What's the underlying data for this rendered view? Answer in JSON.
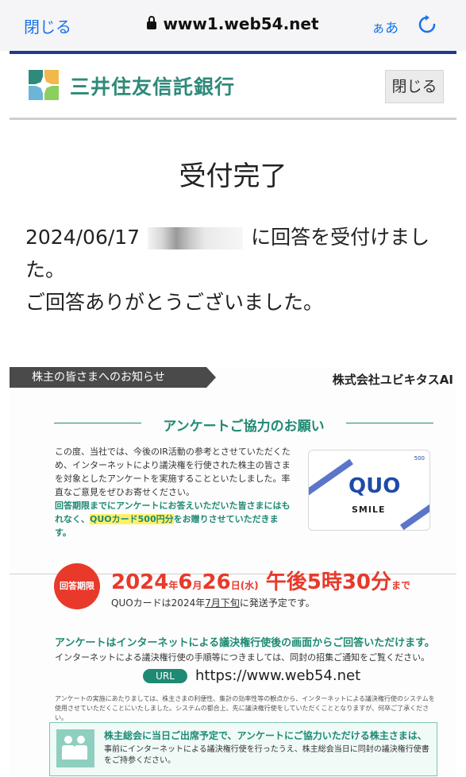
{
  "browser": {
    "close_label": "閉じる",
    "url": "www1.web54.net",
    "aa_label": "ぁあ",
    "reload_icon": "reload-icon"
  },
  "bank_header": {
    "name": "三井住友信託銀行",
    "close_button": "閉じる",
    "accent_color": "#2e8a7a"
  },
  "page": {
    "title": "受付完了",
    "message_date": "2024/06/17",
    "message_part1": "に回答を受付けました。",
    "message_part2": "ご回答ありがとうございました。"
  },
  "notice": {
    "tag": "株主の皆さまへのお知らせ",
    "company": "株式会社ユビキタスAI",
    "heading": "アンケートご協力のお願い",
    "body_plain": "この度、当社では、今後のIR活動の参考とさせていただくため、インターネットにより議決権を行使された株主の皆さまを対象としたアンケートを実施することといたしました。率直なご意見をぜひお寄せください。",
    "body_green1": "回答期限までにアンケートにお答えいただいた皆さまにはもれなく、",
    "body_highlight": "QUOカード500円分",
    "body_green2": "をお贈りさせていただきます。",
    "quo_logo": "QUO",
    "quo_smile": "SMILE",
    "quo_corner": "500",
    "deadline_badge": "回答期限",
    "deadline_date": "2024",
    "deadline_year_suffix": "年",
    "deadline_month": "6",
    "deadline_month_suffix": "月",
    "deadline_day": "26",
    "deadline_day_suffix": "日(水)",
    "deadline_time": "午後5時30分",
    "deadline_until": "まで",
    "ship_text1": "QUOカードは2024年",
    "ship_underline": "7月下旬",
    "ship_text2": "に発送予定です。",
    "internet_title": "アンケートはインターネットによる議決権行使後の画面からご回答いただけます。",
    "internet_sub": "インターネットによる議決権行使の手順等につきましては、同封の招集ご通知をご覧ください。",
    "url_label": "URL",
    "url_value": "https://www.web54.net",
    "fine_print": "アンケートの実施にあたりましては、株主さまの利便性、集計の効率性等の観点から、インターネットによる議決権行使のシステムを使用させていただくことにいたしました。システムの都合上、先に議決権行使をしていただくこととなりますが、何卒ご了承ください。",
    "box_title": "株主総会に当日ご出席予定で、アンケートにご協力いただける株主さまは、",
    "box_body": "事前にインターネットによる議決権行使を行ったうえ、株主総会当日に同封の議決権行使書をご持参ください。",
    "colors": {
      "green": "#1e8a73",
      "red": "#e8392b",
      "highlight": "#fff06a"
    }
  }
}
